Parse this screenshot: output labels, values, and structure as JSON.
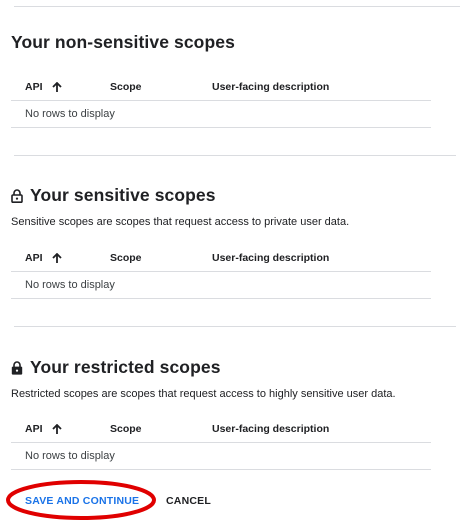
{
  "sections": [
    {
      "title": "Your non-sensitive scopes",
      "icon": "",
      "description": ""
    },
    {
      "title": "Your sensitive scopes",
      "icon": "lock-open-icon",
      "description": "Sensitive scopes are scopes that request access to private user data."
    },
    {
      "title": "Your restricted scopes",
      "icon": "lock-icon",
      "description": "Restricted scopes are scopes that request access to highly sensitive user data."
    }
  ],
  "table": {
    "columns": [
      "API",
      "Scope",
      "User-facing description"
    ],
    "sort_icon": "arrow-up-icon",
    "empty_text": "No rows to display"
  },
  "actions": {
    "save_label": "SAVE AND CONTINUE",
    "cancel_label": "CANCEL"
  },
  "colors": {
    "primary": "#1a73e8",
    "highlight": "#e00000",
    "divider": "#dadce0",
    "text": "#202124"
  }
}
